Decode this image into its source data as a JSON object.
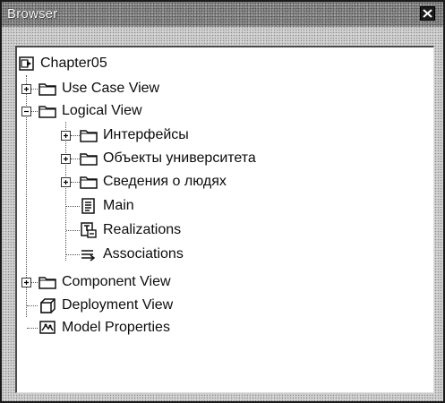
{
  "window": {
    "title": "Browser"
  },
  "tree": {
    "root": {
      "label": "Chapter05"
    },
    "use_case_view": {
      "label": "Use Case View"
    },
    "logical_view": {
      "label": "Logical View",
      "children": [
        {
          "label": "Интерфейсы"
        },
        {
          "label": "Объекты университета"
        },
        {
          "label": "Сведения о людях"
        },
        {
          "label": "Main"
        },
        {
          "label": "Realizations"
        },
        {
          "label": "Associations"
        }
      ]
    },
    "component_view": {
      "label": "Component View"
    },
    "deployment_view": {
      "label": "Deployment View"
    },
    "model_properties": {
      "label": "Model Properties"
    }
  },
  "colors": {
    "title_bar": "#8a8a8a",
    "panel_background": "#ffffff",
    "frame_texture": "#cfcfcf"
  }
}
